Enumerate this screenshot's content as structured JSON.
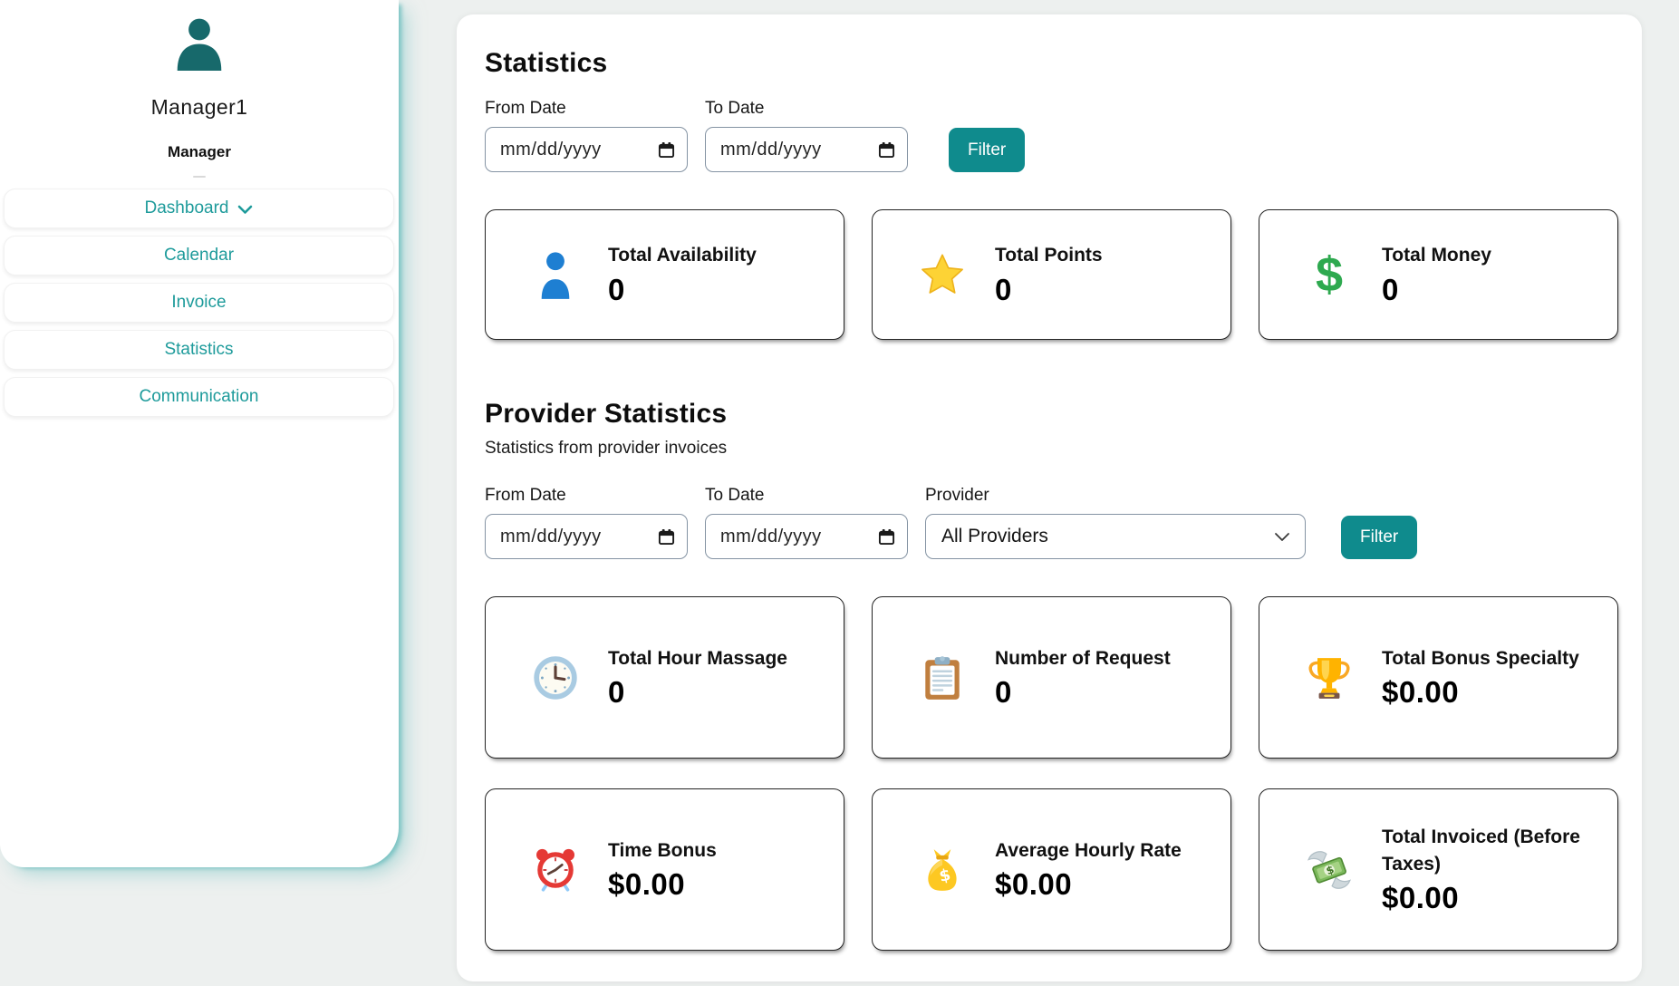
{
  "page": {
    "background": "#edf0ef",
    "accent_teal": "#0f8b8d",
    "nav_teal": "#1e9b9b",
    "avatar_teal": "#17696b"
  },
  "icons": {
    "dollar_glyph": "$"
  },
  "sidebar": {
    "user": {
      "name": "Manager1",
      "role": "Manager"
    },
    "items": [
      {
        "label": "Dashboard",
        "icon": "chevron-down-icon"
      },
      {
        "label": "Calendar"
      },
      {
        "label": "Invoice"
      },
      {
        "label": "Statistics"
      },
      {
        "label": "Communication"
      }
    ]
  },
  "statistics": {
    "title": "Statistics",
    "filter": {
      "from_label": "From Date",
      "to_label": "To Date",
      "date_placeholder": "mm/dd/yyyy",
      "button": "Filter"
    },
    "cards": [
      {
        "icon": "person-icon",
        "title": "Total Availability",
        "value": "0"
      },
      {
        "icon": "star-icon",
        "title": "Total Points",
        "value": "0"
      },
      {
        "icon": "dollar-icon",
        "title": "Total Money",
        "value": "0"
      }
    ]
  },
  "provider_statistics": {
    "title": "Provider Statistics",
    "subtitle": "Statistics from provider invoices",
    "filter": {
      "from_label": "From Date",
      "to_label": "To Date",
      "provider_label": "Provider",
      "date_placeholder": "mm/dd/yyyy",
      "provider_value": "All Providers",
      "button": "Filter"
    },
    "cards": [
      {
        "icon": "clock-icon",
        "title": "Total Hour Massage",
        "value": "0"
      },
      {
        "icon": "clipboard-icon",
        "title": "Number of Request",
        "value": "0"
      },
      {
        "icon": "trophy-icon",
        "title": "Total Bonus Specialty",
        "value": "$0.00"
      },
      {
        "icon": "alarm-clock-icon",
        "title": "Time Bonus",
        "value": "$0.00"
      },
      {
        "icon": "money-bag-icon",
        "title": "Average Hourly Rate",
        "value": "$0.00"
      },
      {
        "icon": "money-wings-icon",
        "title": "Total Invoiced (Before Taxes)",
        "value": "$0.00"
      }
    ]
  }
}
